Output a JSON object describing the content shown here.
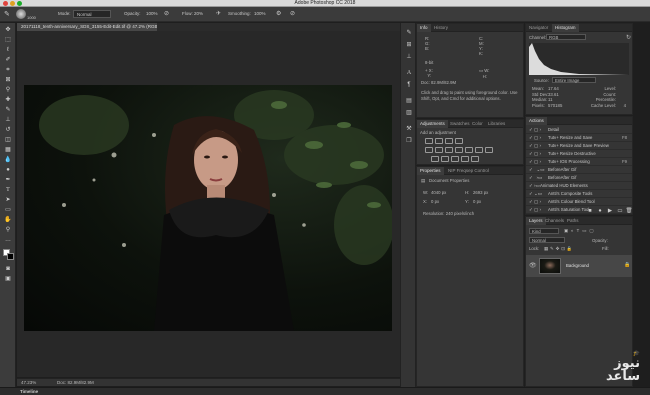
{
  "window": {
    "title": "Adobe Photoshop CC 2018"
  },
  "options_bar": {
    "brush_size": "1000",
    "mode_label": "Mode:",
    "mode_value": "Normal",
    "opacity_label": "Opacity:",
    "opacity_value": "100%",
    "flow_label": "Flow:",
    "flow_value": "20%",
    "smoothing_label": "Smoothing:",
    "smoothing_value": "100%"
  },
  "document": {
    "tab_label": "20171118_tenth-anniversary_SDS_3155-Edit-Edit.tif @ 47.2% (RGB/16*) *",
    "zoom": "47.23%",
    "doc_size": "Doc: 82.9M/82.9M"
  },
  "timeline": {
    "label": "Timeline"
  },
  "info_panel": {
    "tabs": [
      "Info",
      "History"
    ],
    "doc_size": "Doc: 82.9M/82.9M",
    "hint": "Click and drag to paint using foreground color. Use Shift, Opt, and Cmd for additional options."
  },
  "navigator_panel": {
    "tabs": [
      "Navigator",
      "Histogram"
    ],
    "channel_label": "Channel:",
    "channel_value": "RGB",
    "source_label": "Source:",
    "source_value": "Entire Image",
    "stats": [
      [
        "Mean:",
        "17.64",
        "Level:",
        ""
      ],
      [
        "Std Dev:",
        "33.61",
        "Count:",
        ""
      ],
      [
        "Median:",
        "11",
        "Percentile:",
        ""
      ],
      [
        "Pixels:",
        "570185",
        "Cache Level:",
        "4"
      ]
    ]
  },
  "adjustments_panel": {
    "tabs": [
      "Adjustments",
      "Swatches",
      "Color",
      "Libraries"
    ],
    "add_label": "Add an adjustment"
  },
  "properties_panel": {
    "tabs": [
      "Properties",
      "NIP Freqsep Control"
    ],
    "heading": "Document Properties",
    "w_label": "W:",
    "w_value": "4040 px",
    "h_label": "H:",
    "h_value": "2693 px",
    "x_label": "X:",
    "x_value": "0 px",
    "y_label": "Y:",
    "y_value": "0 px",
    "resolution": "Resolution: 240 pixels/inch"
  },
  "actions_panel": {
    "title": "Actions",
    "items": [
      {
        "label": "Detail",
        "shortcut": ""
      },
      {
        "label": "Tutv+ Resize and Save",
        "shortcut": "F8"
      },
      {
        "label": "Tutv+ Resize and Save Preview",
        "shortcut": ""
      },
      {
        "label": "Tutv+ Resize Destructive",
        "shortcut": ""
      },
      {
        "label": "Tutv+ IOS Processing",
        "shortcut": "F9"
      },
      {
        "label": "BeforeAfter Gif",
        "shortcut": ""
      },
      {
        "label": "BeforeAfter Gif",
        "shortcut": ""
      },
      {
        "label": "Animated HUD Elements",
        "shortcut": ""
      },
      {
        "label": "Antti's Composite Tools",
        "shortcut": ""
      },
      {
        "label": "Antti's Colour Blend Tool",
        "shortcut": ""
      },
      {
        "label": "Antti's Saturation Tool",
        "shortcut": ""
      }
    ]
  },
  "layers_panel": {
    "tabs": [
      "Layers",
      "Channels",
      "Paths"
    ],
    "kind_label": "Kind",
    "blend_mode": "Normal",
    "opacity_label": "Opacity:",
    "lock_label": "Lock:",
    "fill_label": "Fill:",
    "layer_name": "Background"
  },
  "watermark": {
    "line1": "نیوز",
    "line2": "ساعد"
  }
}
